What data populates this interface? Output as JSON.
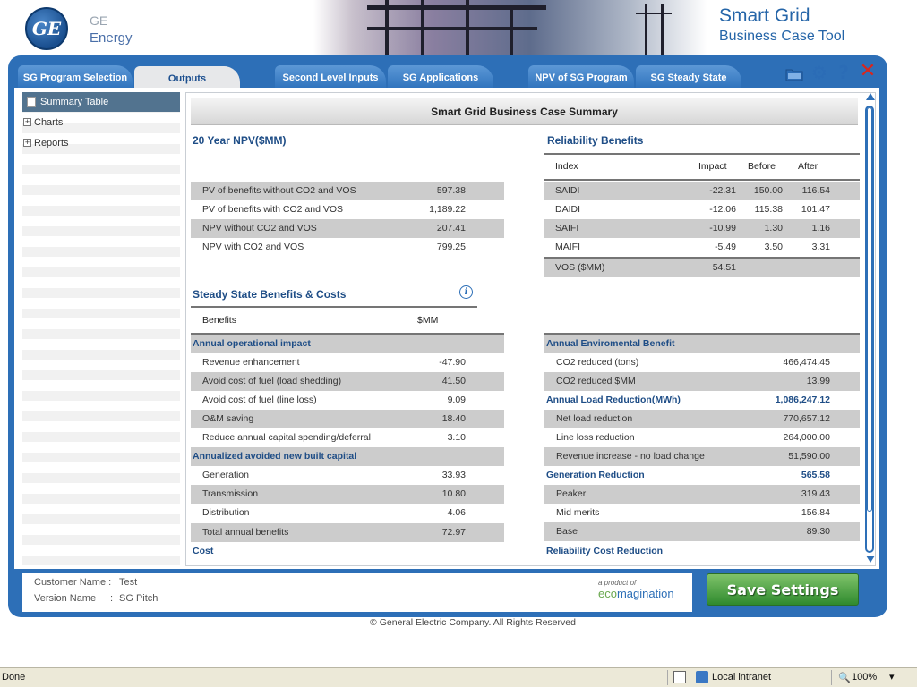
{
  "header": {
    "brand_line1": "GE",
    "brand_line2": "Energy",
    "logo_text": "GE",
    "product_line1": "Smart Grid",
    "product_line2": "Business Case Tool"
  },
  "tabs": [
    {
      "label": "SG Program Selection",
      "active": false
    },
    {
      "label": "Outputs",
      "active": true
    },
    {
      "label": "Second Level Inputs",
      "active": false
    },
    {
      "label": "SG Applications",
      "active": false
    },
    {
      "label": "NPV of SG Program",
      "active": false
    },
    {
      "label": "SG Steady State",
      "active": false
    }
  ],
  "toolbar": {
    "icons": [
      "folder-icon",
      "gear-icon",
      "help-icon",
      "close-icon"
    ]
  },
  "nav": [
    {
      "label": "Summary Table"
    },
    {
      "label": "Charts"
    },
    {
      "label": "Reports"
    }
  ],
  "summary": {
    "title": "Smart Grid Business Case Summary",
    "npv": {
      "heading": "20 Year NPV($MM)",
      "rows": [
        {
          "label": "PV of benefits without CO2 and VOS",
          "value": "597.38"
        },
        {
          "label": "PV of benefits with CO2 and VOS",
          "value": "1,189.22"
        },
        {
          "label": "NPV without CO2 and VOS",
          "value": "207.41"
        },
        {
          "label": "NPV with CO2 and VOS",
          "value": "799.25"
        }
      ]
    },
    "reliability": {
      "heading": "Reliability Benefits",
      "columns": [
        "Index",
        "Impact",
        "Before",
        "After"
      ],
      "rows": [
        {
          "index": "SAIDI",
          "impact": "-22.31",
          "before": "150.00",
          "after": "116.54"
        },
        {
          "index": "DAIDI",
          "impact": "-12.06",
          "before": "115.38",
          "after": "101.47"
        },
        {
          "index": "SAIFI",
          "impact": "-10.99",
          "before": "1.30",
          "after": "1.16"
        },
        {
          "index": "MAIFI",
          "impact": "-5.49",
          "before": "3.50",
          "after": "3.31"
        }
      ],
      "vos_label": "VOS ($MM)",
      "vos_value": "54.51"
    },
    "steady": {
      "heading": "Steady State Benefits & Costs",
      "col_benefits": "Benefits",
      "col_unit": "$MM",
      "info_icon": "i",
      "rows": [
        {
          "label": "Annual operational impact",
          "value": "",
          "category": true
        },
        {
          "label": "Revenue enhancement",
          "value": "-47.90"
        },
        {
          "label": "Avoid cost of fuel (load shedding)",
          "value": "41.50"
        },
        {
          "label": "Avoid cost of fuel (line loss)",
          "value": "9.09"
        },
        {
          "label": "O&M saving",
          "value": "18.40"
        },
        {
          "label": "Reduce annual capital spending/deferral",
          "value": "3.10"
        },
        {
          "label": "Annualized avoided new built capital",
          "value": "",
          "category": true
        },
        {
          "label": "Generation",
          "value": "33.93"
        },
        {
          "label": "Transmission",
          "value": "10.80"
        },
        {
          "label": "Distribution",
          "value": "4.06"
        }
      ],
      "total_label": "Total annual benefits",
      "total_value": "72.97",
      "cost_label": "Cost"
    },
    "environment": {
      "rows": [
        {
          "label": "Annual Enviromental Benefit",
          "value": "",
          "category": true
        },
        {
          "label": "CO2 reduced (tons)",
          "value": "466,474.45"
        },
        {
          "label": "CO2 reduced $MM",
          "value": "13.99"
        },
        {
          "label": "Annual Load Reduction(MWh)",
          "value": "1,086,247.12",
          "category": true
        },
        {
          "label": "Net load reduction",
          "value": "770,657.12"
        },
        {
          "label": "Line loss reduction",
          "value": "264,000.00"
        },
        {
          "label": "Revenue increase - no load change",
          "value": "51,590.00"
        },
        {
          "label": "Generation Reduction",
          "value": "565.58",
          "category": true
        },
        {
          "label": "Peaker",
          "value": "319.43"
        },
        {
          "label": "Mid merits",
          "value": "156.84"
        },
        {
          "label": "Base",
          "value": "89.30"
        }
      ],
      "footer_label": "Reliability Cost Reduction"
    }
  },
  "footer": {
    "customer_label": "Customer Name :",
    "customer_value": "Test",
    "version_label": "Version Name",
    "version_colon": ":",
    "version_value": "SG Pitch",
    "eco_line1": "a product of",
    "eco_line2a": "eco",
    "eco_line2b": "magination",
    "save_label": "Save Settings",
    "copyright": "© General Electric Company. All Rights Reserved"
  },
  "statusbar": {
    "status": "Done",
    "zone": "Local intranet",
    "zoom": "100%"
  },
  "colors": {
    "frame_blue": "#2d6fb7",
    "heading_blue": "#1e4d86",
    "row_shade": "#cccccc",
    "save_green": "#2f8a2e",
    "close_red": "#d9261c"
  }
}
